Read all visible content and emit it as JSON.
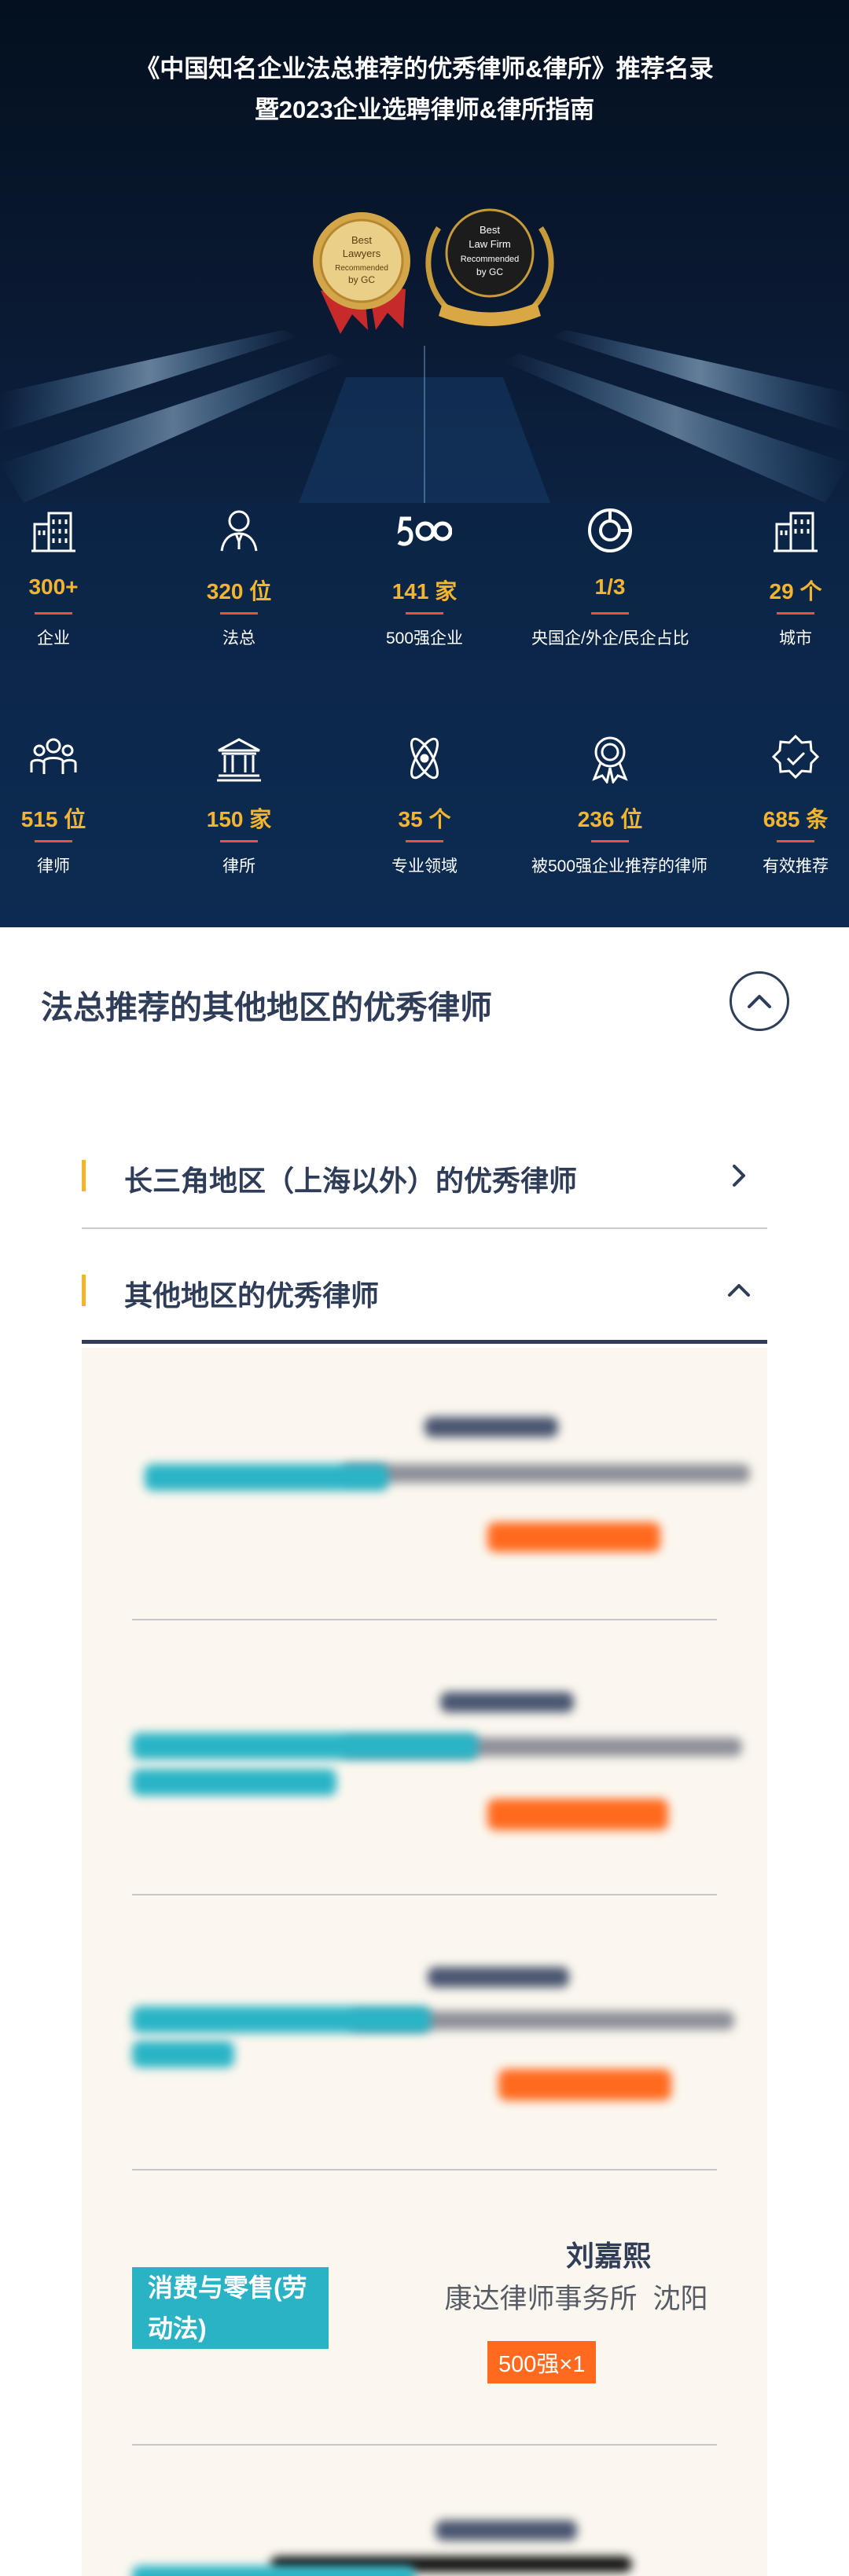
{
  "hero": {
    "title_line1": "《中国知名企业法总推荐的优秀律师&律所》推荐名录",
    "title_line2": "暨2023企业选聘律师&律所指南",
    "badge_left": [
      "Best",
      "Lawyers",
      "Recommended",
      "by GC"
    ],
    "badge_right": [
      "Best",
      "Law Firm",
      "Recommended",
      "by GC"
    ]
  },
  "stats_row1": [
    {
      "value": "300+",
      "label": "企业",
      "icon": "building-icon"
    },
    {
      "value": "320 位",
      "label": "法总",
      "icon": "person-icon"
    },
    {
      "value": "141 家",
      "label": "500强企业",
      "icon": "500-icon"
    },
    {
      "value": "1/3",
      "label": "央国企/外企/民企占比",
      "icon": "pie-chart-icon"
    },
    {
      "value": "29 个",
      "label": "城市",
      "icon": "city-icon"
    }
  ],
  "stats_row2": [
    {
      "value": "515 位",
      "label": "律师",
      "icon": "group-icon"
    },
    {
      "value": "150 家",
      "label": "律所",
      "icon": "courthouse-icon"
    },
    {
      "value": "35 个",
      "label": "专业领域",
      "icon": "atom-icon"
    },
    {
      "value": "236 位",
      "label": "被500强企业推荐的律师",
      "icon": "award-icon"
    },
    {
      "value": "685 条",
      "label": "有效推荐",
      "icon": "verified-badge-icon"
    }
  ],
  "section": {
    "title": "法总推荐的其他地区的优秀律师",
    "accordion": [
      {
        "label": "长三角地区（上海以外）的优秀律师",
        "expanded": false
      },
      {
        "label": "其他地区的优秀律师",
        "expanded": true
      }
    ]
  },
  "lawyer_visible": {
    "name": "刘嘉熙",
    "firm": "康达律师事务所",
    "city": "沈阳",
    "badge": "500强×1",
    "tag": "消费与零售(劳动法)"
  },
  "colors": {
    "navy": "#2f3d59",
    "gold": "#f3b52c",
    "orange": "#ff6a1f",
    "teal": "#29b3c5",
    "panel_bg": "#fbf7ef"
  }
}
